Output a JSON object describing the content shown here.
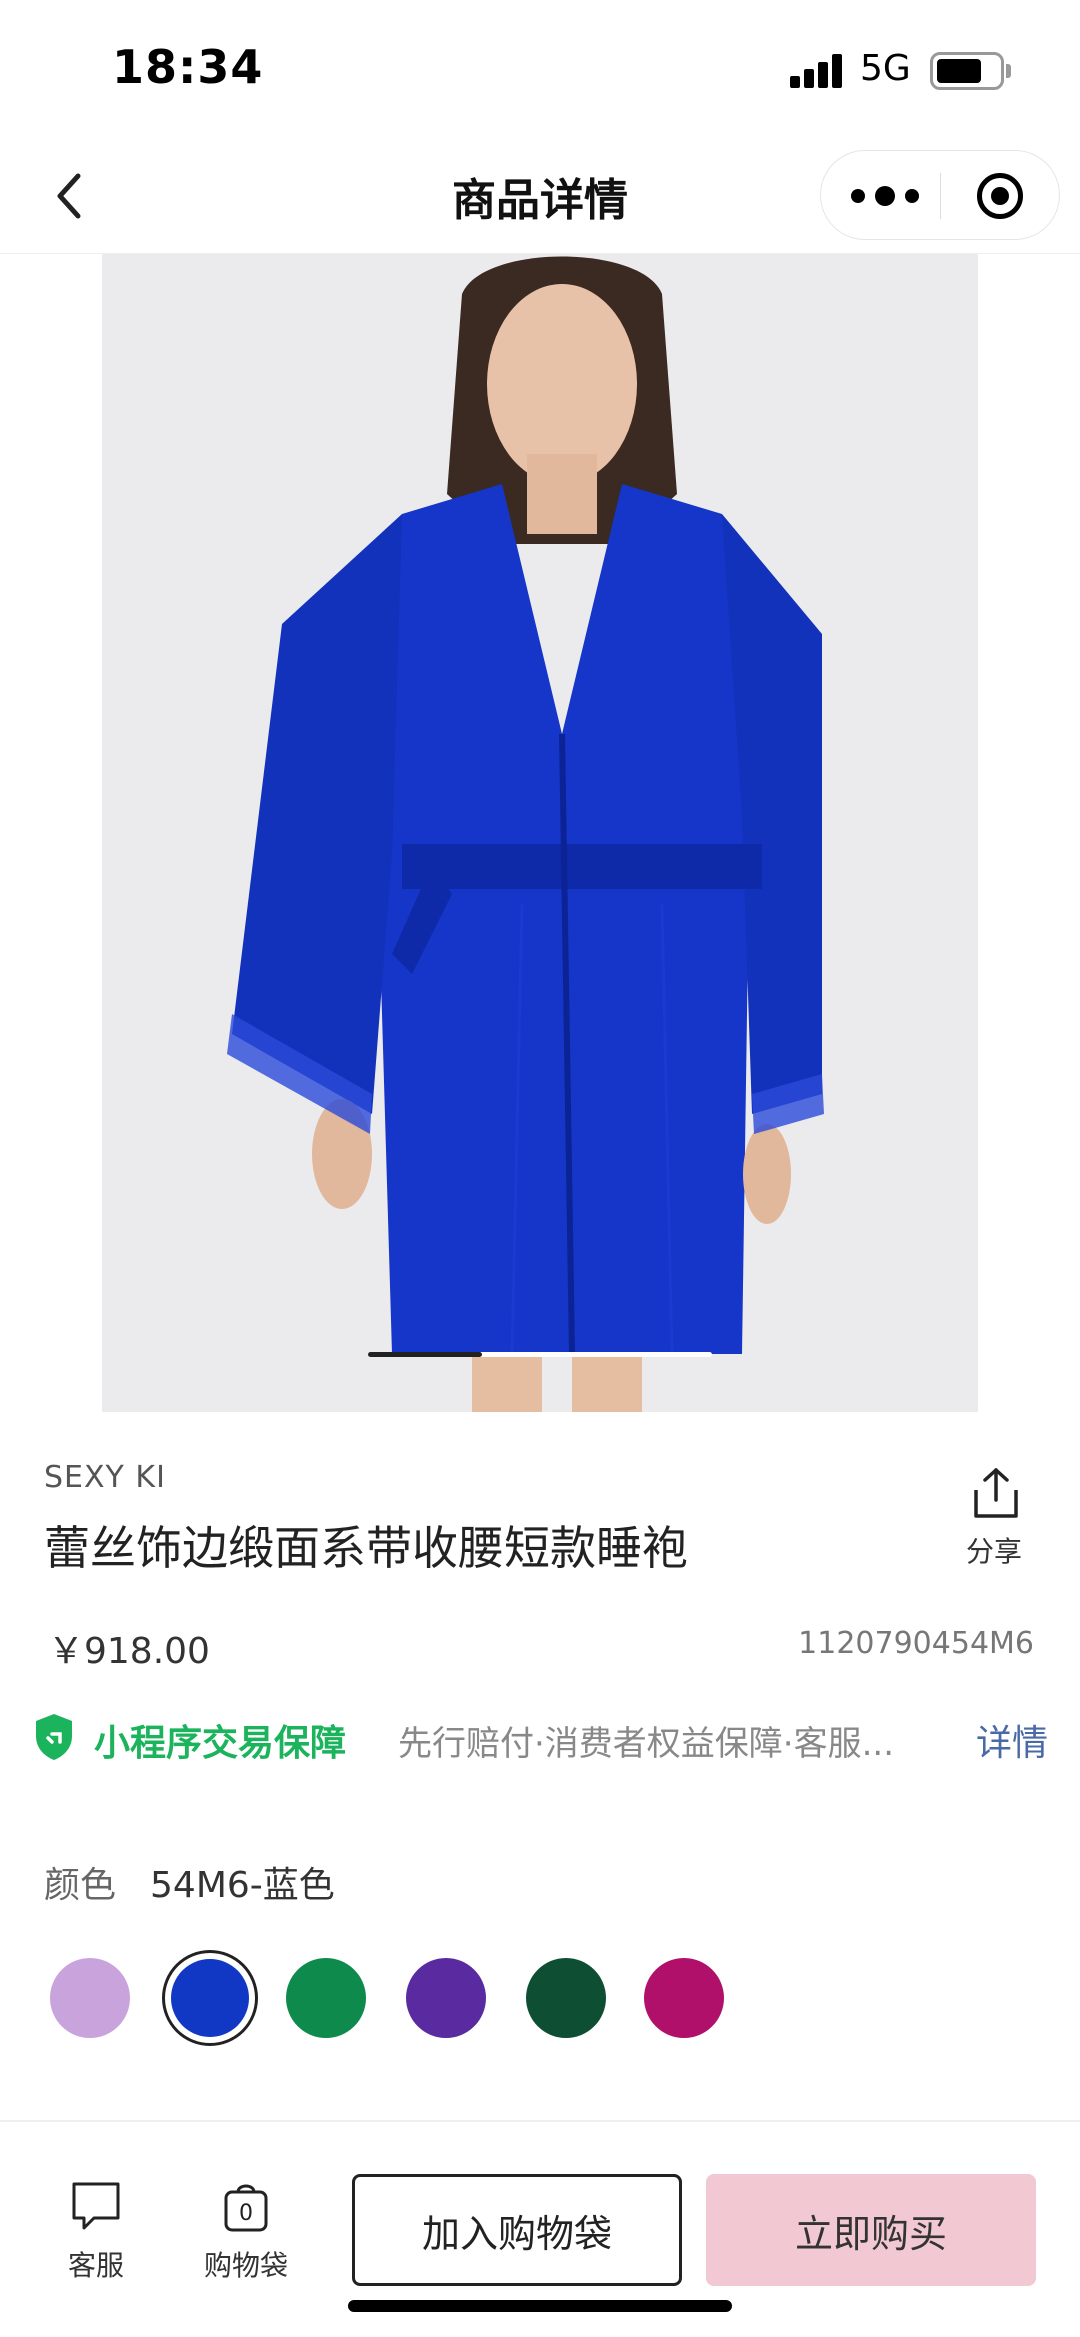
{
  "status_bar": {
    "time": "18:34",
    "network": "5G"
  },
  "nav": {
    "title": "商品详情"
  },
  "product": {
    "brand": "SEXY KI",
    "title": "蕾丝饰边缎面系带收腰短款睡袍",
    "price": "￥918.00",
    "sku": "1120790454M6",
    "image_description": "Model wearing blue satin robe",
    "gallery_progress": 0.33
  },
  "share": {
    "label": "分享"
  },
  "guarantee": {
    "name": "小程序交易保障",
    "description": "先行赔付·消费者权益保障·客服...",
    "link": "详情"
  },
  "color": {
    "label": "颜色",
    "selected": "54M6-蓝色",
    "swatches": [
      {
        "color": "#c9a3dc",
        "selected": false
      },
      {
        "color": "#1038c4",
        "selected": true
      },
      {
        "color": "#0d8a4c",
        "selected": false
      },
      {
        "color": "#5a2aa0",
        "selected": false
      },
      {
        "color": "#0e4f34",
        "selected": false
      },
      {
        "color": "#b0106a",
        "selected": false
      }
    ]
  },
  "bottom_bar": {
    "service_label": "客服",
    "cart_label": "购物袋",
    "cart_count": "0",
    "add_to_cart": "加入购物袋",
    "buy_now": "立即购买"
  },
  "colors": {
    "guarantee_green": "#1bb35c",
    "link_blue": "#4a6aa5",
    "buy_button": "#f2c9d3"
  }
}
